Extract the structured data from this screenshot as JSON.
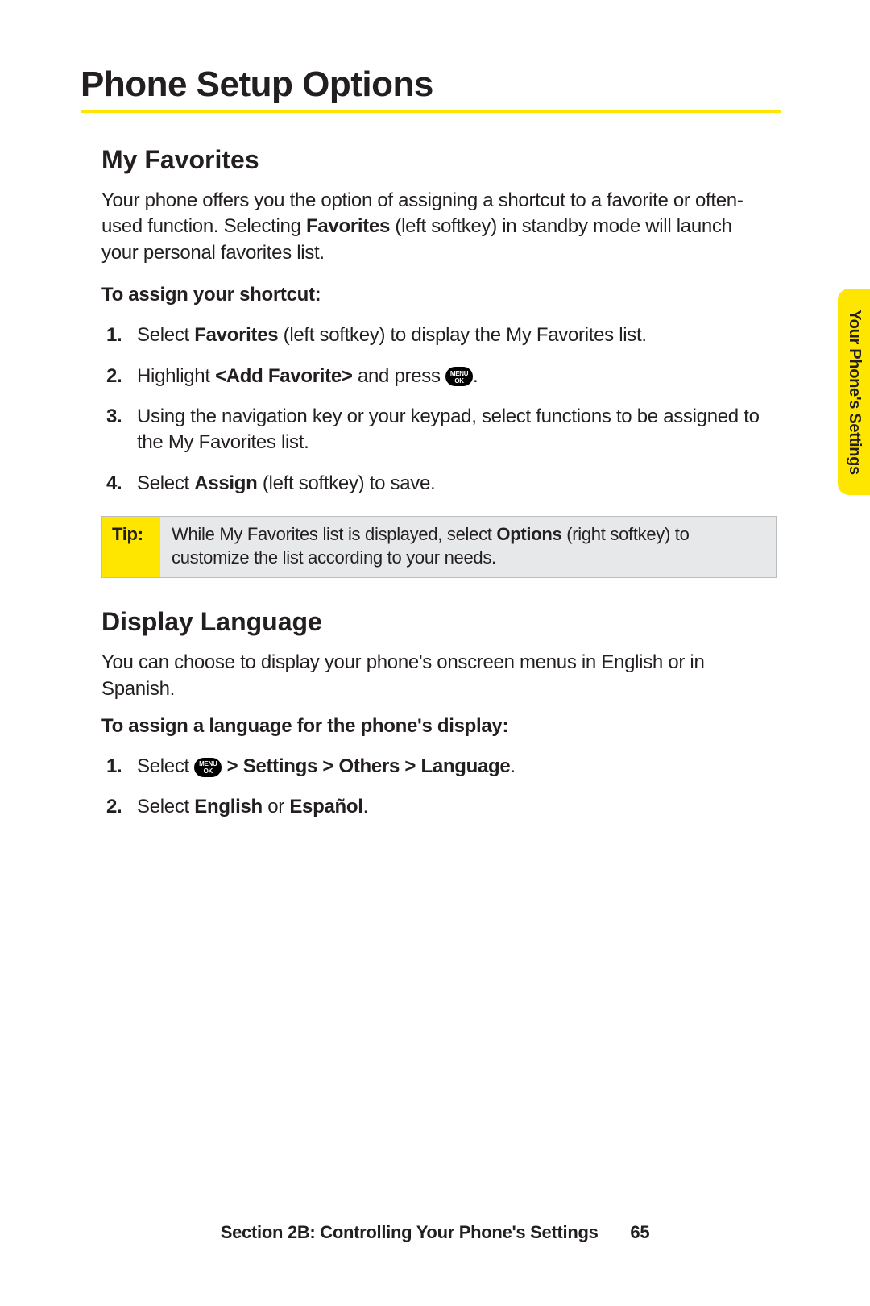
{
  "page_title": "Phone Setup Options",
  "side_tab": "Your Phone's Settings",
  "sections": {
    "favorites": {
      "heading": "My Favorites",
      "intro_pre": "Your phone offers you the option of assigning a shortcut to a favorite or often-used function. Selecting ",
      "intro_bold": "Favorites",
      "intro_post": " (left softkey) in standby mode will launch your personal favorites list.",
      "prompt": "To assign your shortcut:",
      "steps": {
        "s1_pre": "Select ",
        "s1_bold": "Favorites",
        "s1_post": " (left softkey) to display the My Favorites list.",
        "s2_pre": "Highlight ",
        "s2_bold": "<Add Favorite>",
        "s2_mid": " and press ",
        "s3": "Using the navigation key or your keypad, select functions to be assigned to the My Favorites list.",
        "s4_pre": "Select ",
        "s4_bold": "Assign",
        "s4_post": " (left softkey) to save."
      },
      "tip": {
        "label": "Tip:",
        "pre": "While My Favorites list is displayed, select ",
        "bold": "Options",
        "post": " (right softkey) to customize the list according to your needs."
      }
    },
    "language": {
      "heading": "Display Language",
      "intro": "You can choose to display your phone's onscreen menus in English or in Spanish.",
      "prompt": "To assign a language for the phone's display:",
      "steps": {
        "s1_pre": "Select ",
        "s1_bold": " > Settings > Others > Language",
        "s2_pre": "Select ",
        "s2_bold1": "English",
        "s2_mid": " or ",
        "s2_bold2": "Español"
      }
    }
  },
  "menu_icon": {
    "top": "MENU",
    "bottom": "OK"
  },
  "footer": {
    "text": "Section 2B: Controlling Your Phone's Settings",
    "page": "65"
  }
}
